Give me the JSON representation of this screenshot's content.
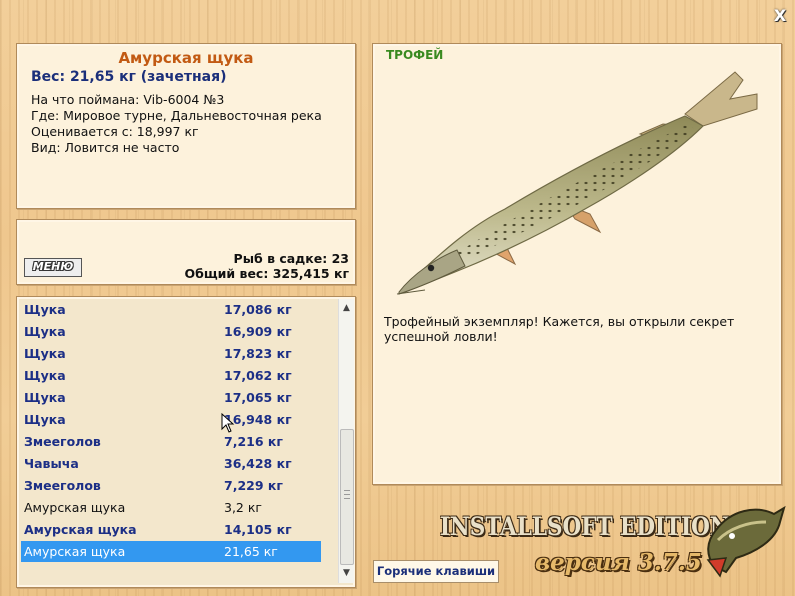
{
  "window": {
    "close_label": "X"
  },
  "catch_info": {
    "title": "Амурская щука",
    "weight_line": "Вес: 21,65 кг (зачетная)",
    "lines": [
      "На что поймана: Vib-6004 №3",
      "Где: Мировое турне, Дальневосточная река",
      "Оценивается с: 18,997 кг",
      "Вид: Ловится не часто"
    ]
  },
  "summary": {
    "menu_label": "МЕНЮ",
    "fish_in_keepnet": "Рыб в садке: 23",
    "total_weight": "Общий вес: 325,415 кг"
  },
  "catch_list": [
    {
      "name": "Щука",
      "weight": "17,086 кг",
      "style": "bold"
    },
    {
      "name": "Щука",
      "weight": "16,909 кг",
      "style": "bold"
    },
    {
      "name": "Щука",
      "weight": "17,823 кг",
      "style": "bold"
    },
    {
      "name": "Щука",
      "weight": "17,062 кг",
      "style": "bold"
    },
    {
      "name": "Щука",
      "weight": "17,065 кг",
      "style": "bold"
    },
    {
      "name": "Щука",
      "weight": "16,948 кг",
      "style": "bold"
    },
    {
      "name": "Змееголов",
      "weight": "7,216 кг",
      "style": "bold"
    },
    {
      "name": "Чавыча",
      "weight": "36,428 кг",
      "style": "bold"
    },
    {
      "name": "Змееголов",
      "weight": "7,229 кг",
      "style": "bold"
    },
    {
      "name": "Амурская щука",
      "weight": "3,2 кг",
      "style": "plain"
    },
    {
      "name": "Амурская щука",
      "weight": "14,105 кг",
      "style": "bold"
    },
    {
      "name": "Амурская щука",
      "weight": "21,65 кг",
      "style": "selected"
    }
  ],
  "trophy": {
    "tag": "ТРОФЕЙ",
    "description": "Трофейный экземпляр! Кажется, вы открыли секрет успешной ловли!"
  },
  "branding": {
    "edition": "INSTALLSOFT EDITION",
    "version": "версия 3.7.5"
  },
  "hotkeys_label": "Горячие клавиши",
  "colors": {
    "accent_title": "#c25a13",
    "weight_text": "#1b2f7a",
    "trophy_tag": "#3a8a20",
    "selection": "#3398f0"
  },
  "icons": [
    "close-icon",
    "scroll-up-icon",
    "scroll-down-icon",
    "pike-fish-image",
    "logo-pike-icon",
    "mouse-cursor-icon"
  ]
}
